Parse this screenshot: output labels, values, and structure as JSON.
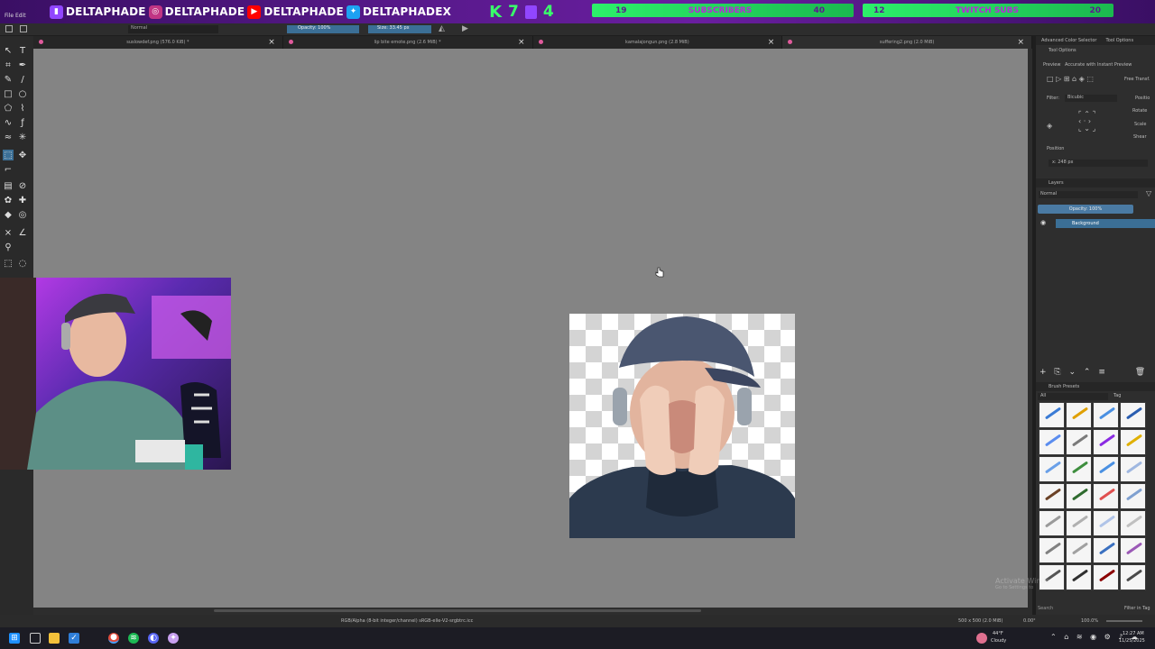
{
  "overlay": {
    "handles": [
      {
        "platform": "twitch",
        "icon": "twitch-icon",
        "label": "DELTAPHADE",
        "color": "#9146ff"
      },
      {
        "platform": "instagram",
        "icon": "instagram-icon",
        "label": "DELTAPHADE",
        "color": "#c13584"
      },
      {
        "platform": "youtube",
        "icon": "youtube-icon",
        "label": "DELTAPHADE",
        "color": "#ff0000"
      },
      {
        "platform": "twitter",
        "icon": "twitter-icon",
        "label": "DELTAPHADEX",
        "color": "#1da1f2"
      }
    ],
    "kick_value": "7",
    "twitch_value": "4",
    "subscribers_goal": {
      "current": "19",
      "label": "SUBSCRIBERS",
      "target": "40"
    },
    "twitch_subs_goal": {
      "current": "12",
      "label": "TWITCH SUBS",
      "target": "20"
    }
  },
  "menu": {
    "file": "File",
    "edit": "Edit"
  },
  "toolbar": {
    "blend_mode": "Normal",
    "opacity": "Opacity: 100%",
    "size": "Size: 33.45 px"
  },
  "tabs": [
    {
      "title": "suslowdef.png (576.0 KiB) *"
    },
    {
      "title": "lip bite emote.png (2.6 MiB) *"
    },
    {
      "title": "kamalajongun.png (2.8 MiB)"
    },
    {
      "title": "suffering2.png (2.0 MiB)"
    }
  ],
  "dock": {
    "top_tabs": [
      "Advanced Color Selector",
      "Tool Options"
    ],
    "tool_options": "Tool Options",
    "preview": "Preview",
    "preview_mode": "Accurate with Instant Preview",
    "free_transform": "Free Transf.",
    "filter_label": "Filter:",
    "filter_value": "Bicubic",
    "positio": "Positio",
    "rotate": "Rotate",
    "scale": "Scale",
    "shear": "Shear",
    "position": "Position",
    "position_x": "x: 248 px",
    "layers": "Layers",
    "layer_blend": "Normal",
    "layer_opacity": "Opacity: 100%",
    "layer_name": "Background",
    "brush_presets": "Brush Presets",
    "brush_filter": "All",
    "brush_tag": "Tag",
    "search": "Search",
    "filter_in_tag": "Filter in Tag"
  },
  "brush_colors": [
    "#3a7bd5",
    "#e0a000",
    "#4a90e2",
    "#2a5db0",
    "#5b8def",
    "#7a7a7a",
    "#8a2be2",
    "#e0b000",
    "#6aa0e8",
    "#3e8e3e",
    "#4a90e2",
    "#9fb7e0",
    "#6b4226",
    "#2f6b2f",
    "#e05050",
    "#7fa0d0",
    "#9a9a9a",
    "#b0b0b0",
    "#b0c4e8",
    "#c0c0c0",
    "#808080",
    "#a0a0a0",
    "#3a70c0",
    "#9b59b6",
    "#555555",
    "#303030",
    "#8b0000",
    "#4a4a4a"
  ],
  "status": {
    "color_profile": "RGB/Alpha (8-bit integer/channel)  sRGB-elle-V2-srgbtrc.icc",
    "doc_size": "500 x 500 (2.0 MiB)",
    "rotation": "0.00°",
    "zoom": "100.0%"
  },
  "watermark": {
    "title": "Activate Windo",
    "subtitle": "Go to Settings to"
  },
  "taskbar": {
    "weather_temp": "44°F",
    "weather_desc": "Cloudy",
    "time": "12:27 AM",
    "date": "11/25/2025"
  }
}
